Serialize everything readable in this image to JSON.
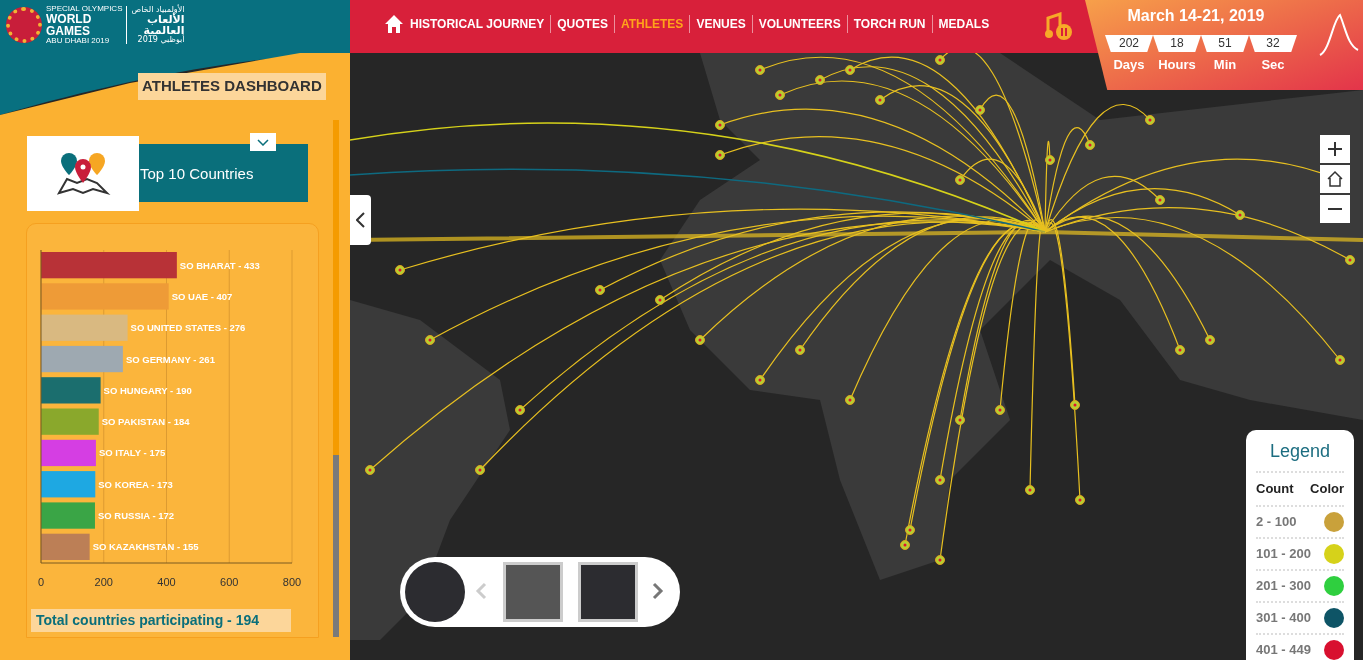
{
  "logo": {
    "org": "SPECIAL OLYMPICS",
    "name_line_1": "WORLD",
    "name_line_2": "GAMES",
    "place": "ABU DHABI 2019",
    "arabic_line_1": "الألعاب",
    "arabic_line_2": "العالمية",
    "arabic_top": "الأولمبياد الخاص",
    "arabic_bottom": "أبوظبي 2019"
  },
  "nav": [
    {
      "label": "HISTORICAL JOURNEY",
      "selected": false
    },
    {
      "label": "QUOTES",
      "selected": false
    },
    {
      "label": "ATHLETES",
      "selected": true
    },
    {
      "label": "VENUES",
      "selected": false
    },
    {
      "label": "VOLUNTEERS",
      "selected": false
    },
    {
      "label": "TORCH RUN",
      "selected": false
    },
    {
      "label": "MEDALS",
      "selected": false
    }
  ],
  "countdown": {
    "dates": "March 14-21, 2019",
    "units": [
      {
        "value": "202",
        "label": "Days"
      },
      {
        "value": "18",
        "label": "Hours"
      },
      {
        "value": "51",
        "label": "Min"
      },
      {
        "value": "32",
        "label": "Sec"
      }
    ]
  },
  "sidebar": {
    "title": "ATHLETES DASHBOARD",
    "panel_title": "Top 10 Countries",
    "total": "Total countries participating - 194",
    "chart_data": {
      "type": "bar",
      "orientation": "horizontal",
      "grid": true,
      "series": [
        {
          "name": "SO BHARAT - 433",
          "color": "#b83237",
          "values": [
            433
          ]
        },
        {
          "name": "SO UAE - 407",
          "color": "#ee9b37",
          "values": [
            407
          ]
        },
        {
          "name": "SO UNITED STATES - 276",
          "color": "#d9b981",
          "values": [
            276
          ]
        },
        {
          "name": "SO GERMANY - 261",
          "color": "#9ea9b1",
          "values": [
            261
          ]
        },
        {
          "name": "SO HUNGARY - 190",
          "color": "#1b6e6e",
          "values": [
            190
          ]
        },
        {
          "name": "SO PAKISTAN - 184",
          "color": "#8aa82c",
          "values": [
            184
          ]
        },
        {
          "name": "SO ITALY - 175",
          "color": "#d53ee3",
          "values": [
            175
          ]
        },
        {
          "name": "SO KOREA - 173",
          "color": "#1ea8e2",
          "values": [
            173
          ]
        },
        {
          "name": "SO RUSSIA - 172",
          "color": "#3aa546",
          "values": [
            172
          ]
        },
        {
          "name": "SO KAZAKHSTAN - 155",
          "color": "#bc7f56",
          "values": [
            155
          ]
        }
      ],
      "xlim": [
        0,
        800
      ],
      "xticks": [
        0,
        200,
        400,
        600,
        800
      ]
    }
  },
  "legend": {
    "title": "Legend",
    "columns": [
      "Count",
      "Color"
    ],
    "rows": [
      {
        "label": "2 - 100",
        "color": "#c9a13b"
      },
      {
        "label": "101 - 200",
        "color": "#d6d21a"
      },
      {
        "label": "201 - 300",
        "color": "#2fcf3f"
      },
      {
        "label": "301 - 400",
        "color": "#0e5466"
      },
      {
        "label": "401 - 449",
        "color": "#d8102f"
      }
    ]
  }
}
